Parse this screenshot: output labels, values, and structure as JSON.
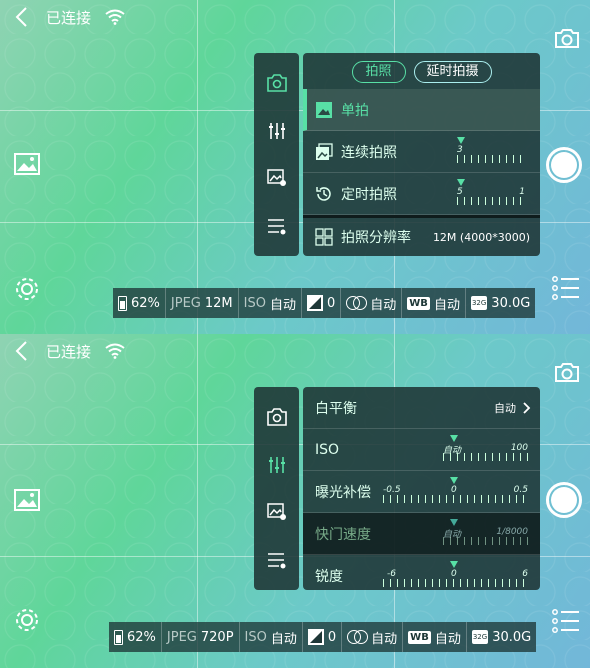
{
  "screen1": {
    "connection": "已连接",
    "tabs": {
      "photo": "拍照",
      "timelapse": "延时拍摄"
    },
    "rows": [
      {
        "label": "单拍"
      },
      {
        "label": "连续拍照",
        "scale_value": "3"
      },
      {
        "label": "定时拍照",
        "scale_left": "5",
        "scale_right": "1"
      }
    ],
    "resolution": {
      "label": "拍照分辨率",
      "value": "12M (4000*3000)"
    },
    "status": {
      "battery": "62%",
      "format": "JPEG",
      "size": "12M",
      "iso_label": "ISO",
      "iso_value": "自动",
      "ev": "0",
      "filter": "自动",
      "wb_badge": "WB",
      "wb_value": "自动",
      "sd_badge": "32G",
      "storage": "30.0G"
    }
  },
  "screen2": {
    "connection": "已连接",
    "wb_row": {
      "label": "白平衡",
      "value": "自动"
    },
    "iso_row": {
      "label": "ISO",
      "left": "自动",
      "right": "100"
    },
    "ev_row": {
      "label": "曝光补偿",
      "left": "-0.5",
      "mid": "0",
      "right": "0.5"
    },
    "shutter_row": {
      "label": "快门速度",
      "left": "自动",
      "right": "1/8000"
    },
    "sharp_row": {
      "label": "锐度",
      "left": "-6",
      "mid": "0",
      "right": "6"
    },
    "status": {
      "battery": "62%",
      "format": "JPEG",
      "size": "720P",
      "iso_label": "ISO",
      "iso_value": "自动",
      "ev": "0",
      "filter": "自动",
      "wb_badge": "WB",
      "wb_value": "自动",
      "sd_badge": "32G",
      "storage": "30.0G"
    }
  },
  "accent_color": "#58e0a6"
}
